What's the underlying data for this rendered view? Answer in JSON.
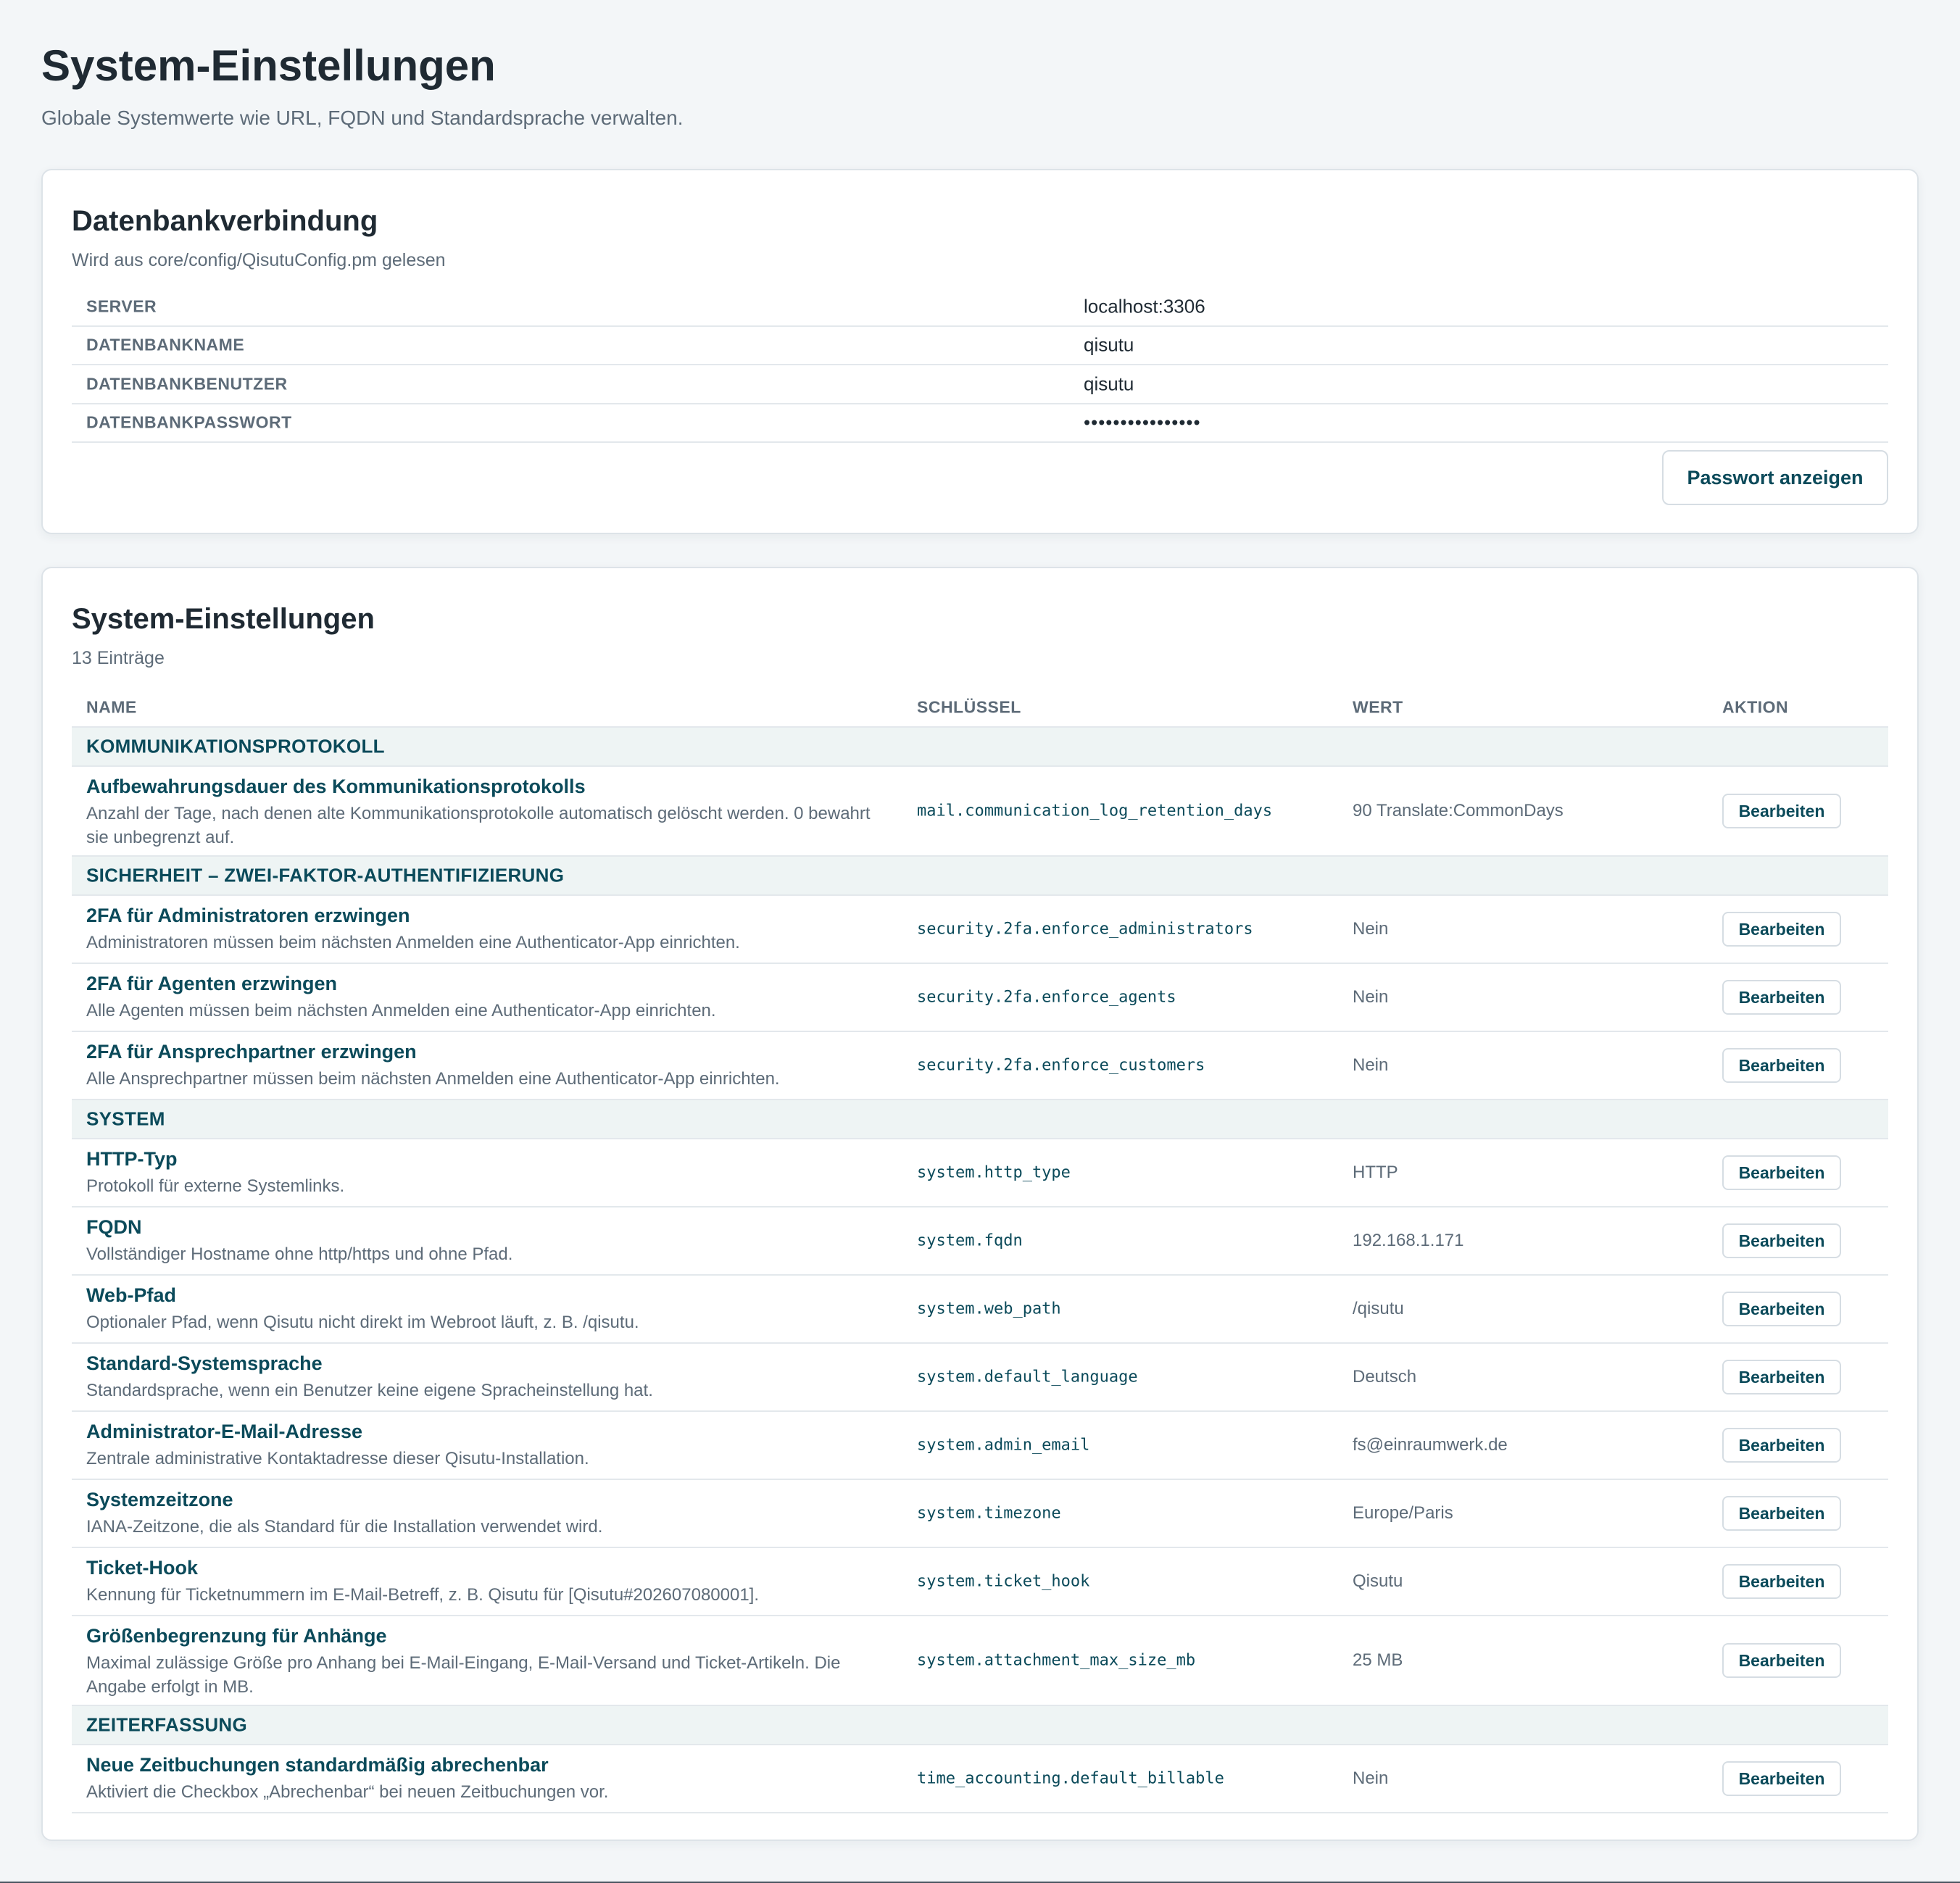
{
  "header": {
    "title": "System-Einstellungen",
    "subtitle": "Globale Systemwerte wie URL, FQDN und Standardsprache verwalten."
  },
  "db": {
    "title": "Datenbankverbindung",
    "subtitle": "Wird aus core/config/QisutuConfig.pm gelesen",
    "rows": [
      {
        "label": "SERVER",
        "value": "localhost:3306"
      },
      {
        "label": "DATENBANKNAME",
        "value": "qisutu"
      },
      {
        "label": "DATENBANKBENUTZER",
        "value": "qisutu"
      },
      {
        "label": "DATENBANKPASSWORT",
        "value": "••••••••••••••••"
      }
    ],
    "show_password_label": "Passwort anzeigen"
  },
  "settings": {
    "title": "System-Einstellungen",
    "count": "13 Einträge",
    "columns": {
      "name": "NAME",
      "key": "SCHLÜSSEL",
      "value": "WERT",
      "action": "AKTION"
    },
    "edit_label": "Bearbeiten",
    "groups": [
      {
        "label": "KOMMUNIKATIONSPROTOKOLL",
        "rows": [
          {
            "name": "Aufbewahrungsdauer des Kommunikationsprotokolls",
            "desc": "Anzahl der Tage, nach denen alte Kommunikationsprotokolle automatisch gelöscht werden. 0 bewahrt sie unbegrenzt auf.",
            "key": "mail.communication_log_retention_days",
            "value": "90 Translate:CommonDays"
          }
        ]
      },
      {
        "label": "SICHERHEIT – ZWEI-FAKTOR-AUTHENTIFIZIERUNG",
        "rows": [
          {
            "name": "2FA für Administratoren erzwingen",
            "desc": "Administratoren müssen beim nächsten Anmelden eine Authenticator-App einrichten.",
            "key": "security.2fa.enforce_administrators",
            "value": "Nein"
          },
          {
            "name": "2FA für Agenten erzwingen",
            "desc": "Alle Agenten müssen beim nächsten Anmelden eine Authenticator-App einrichten.",
            "key": "security.2fa.enforce_agents",
            "value": "Nein"
          },
          {
            "name": "2FA für Ansprechpartner erzwingen",
            "desc": "Alle Ansprechpartner müssen beim nächsten Anmelden eine Authenticator-App einrichten.",
            "key": "security.2fa.enforce_customers",
            "value": "Nein"
          }
        ]
      },
      {
        "label": "SYSTEM",
        "rows": [
          {
            "name": "HTTP-Typ",
            "desc": "Protokoll für externe Systemlinks.",
            "key": "system.http_type",
            "value": "HTTP"
          },
          {
            "name": "FQDN",
            "desc": "Vollständiger Hostname ohne http/https und ohne Pfad.",
            "key": "system.fqdn",
            "value": "192.168.1.171"
          },
          {
            "name": "Web-Pfad",
            "desc": "Optionaler Pfad, wenn Qisutu nicht direkt im Webroot läuft, z. B. /qisutu.",
            "key": "system.web_path",
            "value": "/qisutu"
          },
          {
            "name": "Standard-Systemsprache",
            "desc": "Standardsprache, wenn ein Benutzer keine eigene Spracheinstellung hat.",
            "key": "system.default_language",
            "value": "Deutsch"
          },
          {
            "name": "Administrator-E-Mail-Adresse",
            "desc": "Zentrale administrative Kontaktadresse dieser Qisutu-Installation.",
            "key": "system.admin_email",
            "value": "fs@einraumwerk.de"
          },
          {
            "name": "Systemzeitzone",
            "desc": "IANA-Zeitzone, die als Standard für die Installation verwendet wird.",
            "key": "system.timezone",
            "value": "Europe/Paris"
          },
          {
            "name": "Ticket-Hook",
            "desc": "Kennung für Ticketnummern im E-Mail-Betreff, z. B. Qisutu für [Qisutu#202607080001].",
            "key": "system.ticket_hook",
            "value": "Qisutu"
          },
          {
            "name": "Größenbegrenzung für Anhänge",
            "desc": "Maximal zulässige Größe pro Anhang bei E-Mail-Eingang, E-Mail-Versand und Ticket-Artikeln. Die Angabe erfolgt in MB.",
            "key": "system.attachment_max_size_mb",
            "value": "25 MB"
          }
        ]
      },
      {
        "label": "ZEITERFASSUNG",
        "rows": [
          {
            "name": "Neue Zeitbuchungen standardmäßig abrechenbar",
            "desc": "Aktiviert die Checkbox „Abrechenbar“ bei neuen Zeitbuchungen vor.",
            "key": "time_accounting.default_billable",
            "value": "Nein"
          }
        ]
      }
    ]
  }
}
